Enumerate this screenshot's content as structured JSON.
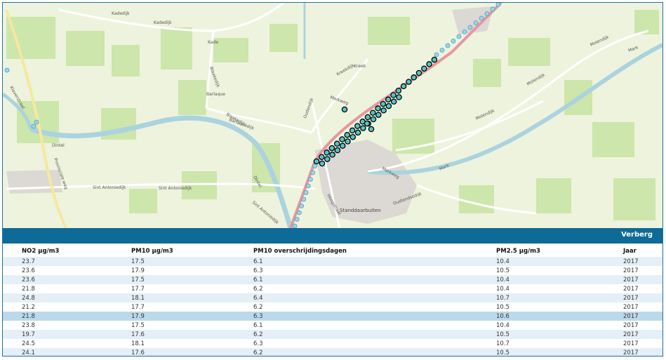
{
  "map": {
    "place_labels": [
      "Kadedijk",
      "Kadedijk",
      "Kade",
      "Blaakedijk",
      "Barlaque",
      "Barlaquedijk",
      "Blaakedijk",
      "Kreek",
      "Kreekdijk",
      "Markweg",
      "Oudendijk",
      "Sint Antoniedijk",
      "Sint Antoniedijk",
      "Sint Antoniedijk",
      "Hoogstraat",
      "Standdaarbuiten",
      "Markweg",
      "Molendijk",
      "Molendijk",
      "Molendijk",
      "Mark",
      "Mark",
      "Dintel",
      "Dintel",
      "Oudlandsedijk",
      "Provinciale weg",
      "Klaverstraat"
    ],
    "colors": {
      "water": "#aad3df",
      "rail": "#e8969e",
      "grass": "#cde6ab",
      "land": "#eef3dd",
      "road": "#ffffff",
      "town": "#dcd8d3",
      "marker_selected": "#55c7c4",
      "marker": "#9fd3e6"
    }
  },
  "panel": {
    "hide_label": "Verberg",
    "columns": [
      "NO2 µg/m3",
      "PM10 µg/m3",
      "PM10 overschrijdingsdagen",
      "PM2.5 µg/m3",
      "Jaar"
    ],
    "rows": [
      [
        "23.7",
        "17.5",
        "6.1",
        "10.4",
        "2017"
      ],
      [
        "23.6",
        "17.9",
        "6.3",
        "10.5",
        "2017"
      ],
      [
        "23.6",
        "17.5",
        "6.1",
        "10.4",
        "2017"
      ],
      [
        "21.8",
        "17.7",
        "6.2",
        "10.4",
        "2017"
      ],
      [
        "24.8",
        "18.1",
        "6.4",
        "10.7",
        "2017"
      ],
      [
        "21.2",
        "17.7",
        "6.2",
        "10.5",
        "2017"
      ],
      [
        "21.8",
        "17.9",
        "6.3",
        "10.6",
        "2017"
      ],
      [
        "23.8",
        "17.5",
        "6.1",
        "10.4",
        "2017"
      ],
      [
        "19.7",
        "17.6",
        "6.2",
        "10.5",
        "2017"
      ],
      [
        "24.5",
        "18.1",
        "6.3",
        "10.7",
        "2017"
      ],
      [
        "24.1",
        "17.6",
        "6.2",
        "10.5",
        "2017"
      ]
    ],
    "selected_row": 6
  }
}
